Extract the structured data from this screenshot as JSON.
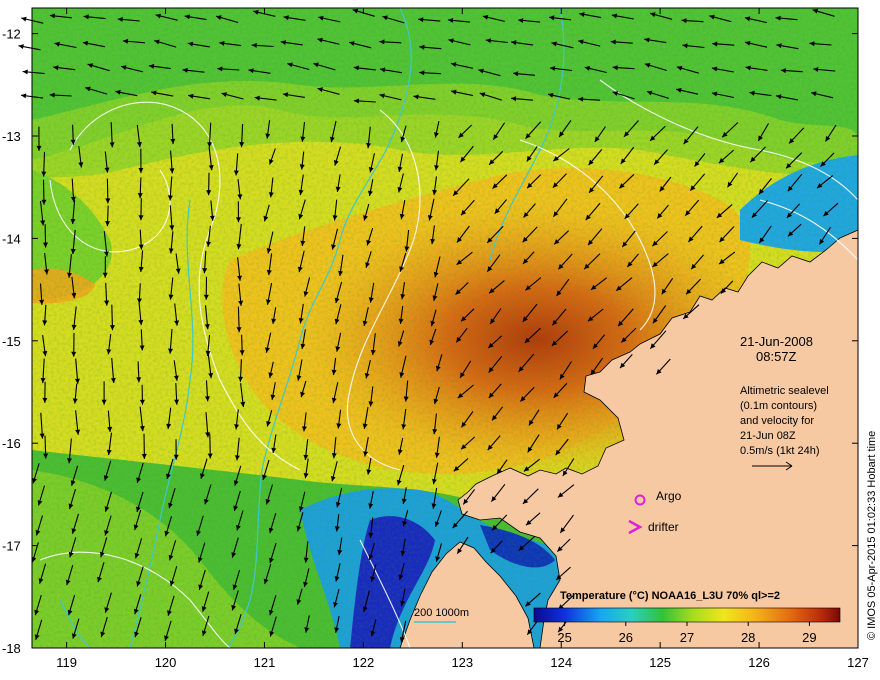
{
  "map": {
    "lon_ticks": [
      "119",
      "120",
      "121",
      "122",
      "123",
      "124",
      "125",
      "126",
      "127"
    ],
    "lat_ticks": [
      "-12",
      "-13",
      "-14",
      "-15",
      "-16",
      "-17",
      "-18"
    ],
    "lon_range": [
      118.65,
      127.0
    ],
    "lat_range": [
      -11.75,
      -18.0
    ]
  },
  "annotations": {
    "date": "21-Jun-2008",
    "time": "08:57Z",
    "info_lines": [
      "Altimetric sealevel",
      "(0.1m contours)",
      "and velocity for",
      "21-Jun 08Z",
      "0.5m/s (1kt 24h)"
    ],
    "argo_label": "Argo",
    "drifter_label": "drifter",
    "bathy_label": "200  1000m",
    "credit": "© IMOS 05-Apr-2015 01:02:33 Hobart time"
  },
  "colorbar": {
    "title": "Temperature (°C) NOAA16_L3U 70% ql>=2",
    "ticks": [
      "25",
      "26",
      "27",
      "28",
      "29"
    ],
    "range": [
      24.5,
      29.5
    ]
  },
  "colors": {
    "land": "#f7c9a2",
    "argo": "#e020d8",
    "drifter": "#e020d8",
    "bathymetry": "#3fc8c8",
    "contour": "#ffffff"
  }
}
